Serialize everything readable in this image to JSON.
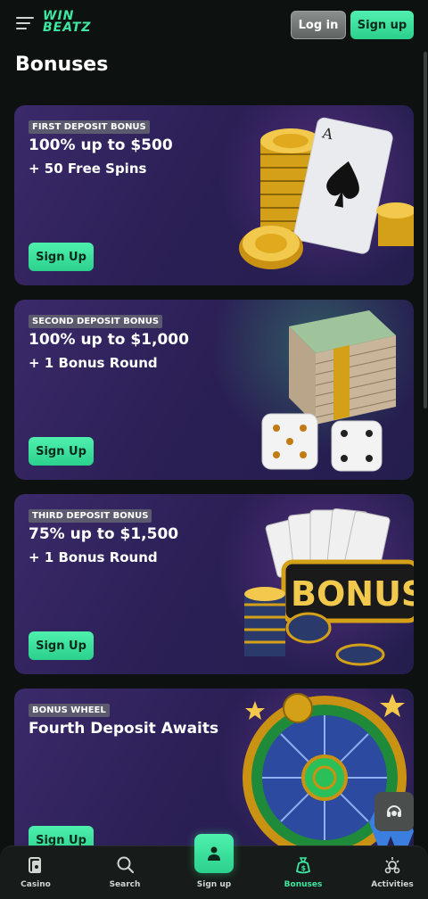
{
  "header": {
    "logo_line1": "WIN",
    "logo_line2": "BEATZ",
    "login_label": "Log in",
    "signup_label": "Sign up"
  },
  "page": {
    "title": "Bonuses"
  },
  "cards": [
    {
      "badge": "FIRST DEPOSIT BONUS",
      "headline": "100% up to $500",
      "subline": "+ 50 Free Spins",
      "button": "Sign Up"
    },
    {
      "badge": "SECOND DEPOSIT BONUS",
      "headline": "100% up to $1,000",
      "subline": "+ 1 Bonus Round",
      "button": "Sign Up"
    },
    {
      "badge": "THIRD DEPOSIT BONUS",
      "headline": "75% up to $1,500",
      "subline": "+ 1 Bonus Round",
      "button": "Sign Up"
    },
    {
      "badge": "BONUS WHEEL",
      "headline": "Fourth Deposit Awaits",
      "subline": "",
      "button": "Sign Up"
    }
  ],
  "art": {
    "bonus_sign": "BONUS",
    "card_rank": "A"
  },
  "bottom_nav": {
    "items": [
      {
        "label": "Casino",
        "icon": "casino-icon"
      },
      {
        "label": "Search",
        "icon": "search-icon"
      },
      {
        "label": "Sign up",
        "icon": "user-icon"
      },
      {
        "label": "Bonuses",
        "icon": "bonus-bag-icon"
      },
      {
        "label": "Activities",
        "icon": "activities-icon"
      }
    ],
    "active": "Bonuses"
  },
  "colors": {
    "accent": "#3ee6a0",
    "background": "#0d1210",
    "card": "#2b1f55"
  }
}
